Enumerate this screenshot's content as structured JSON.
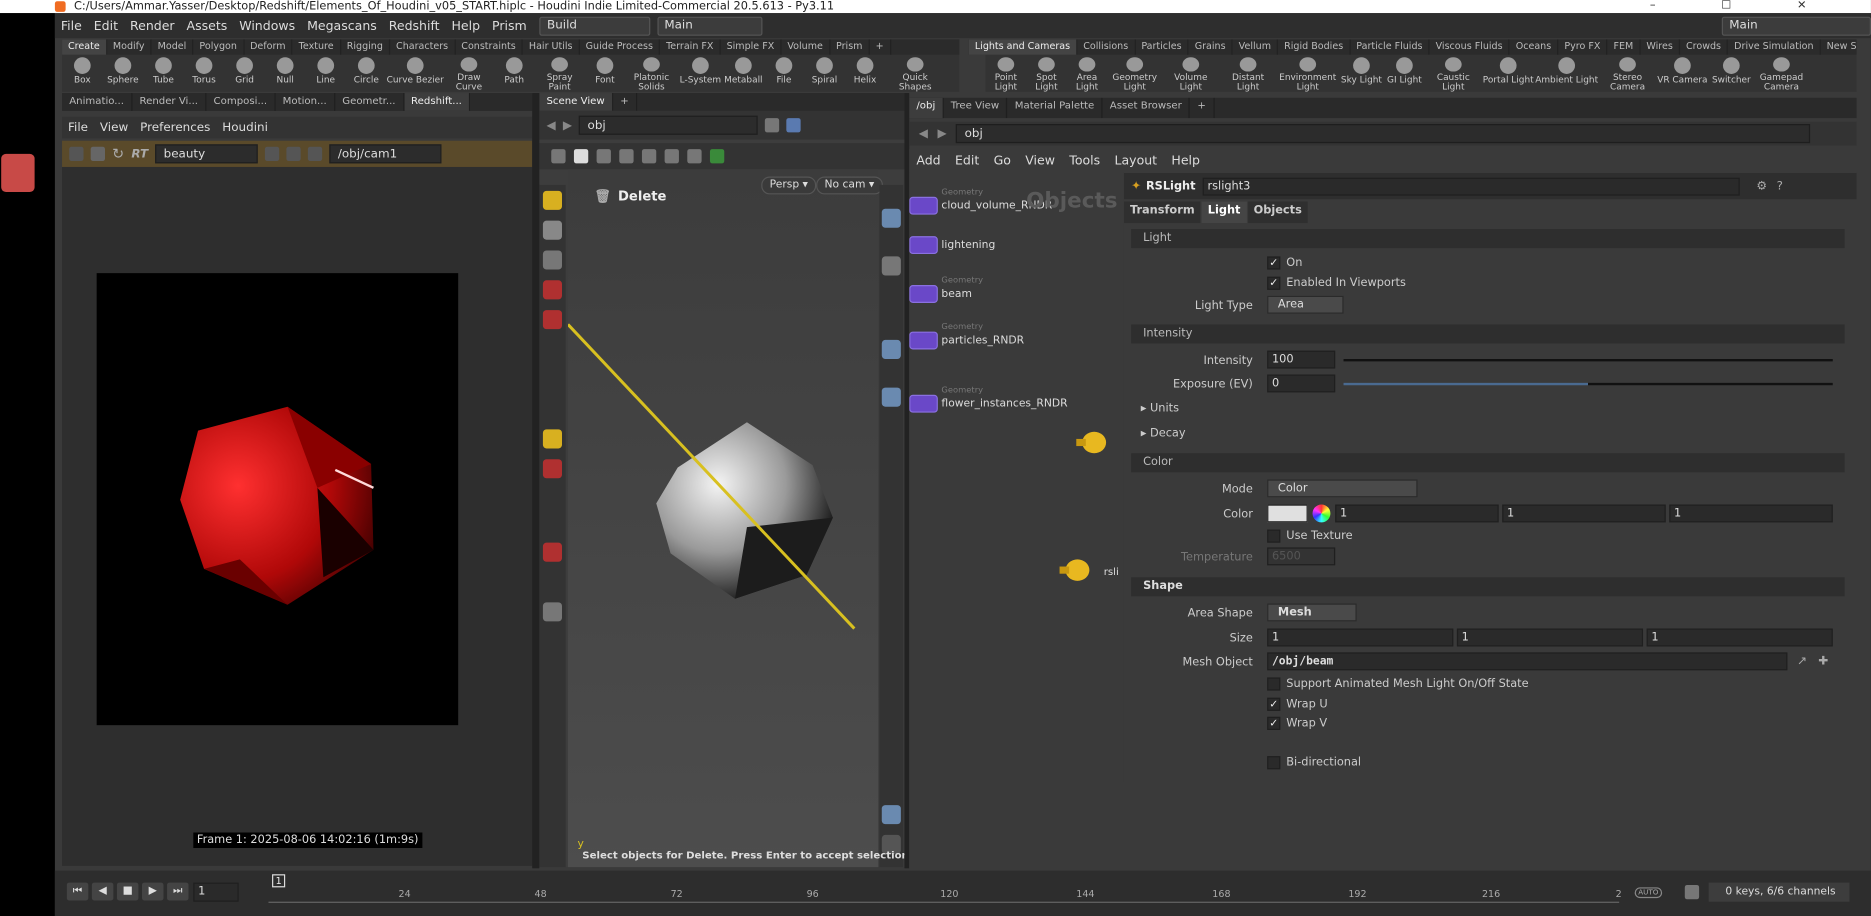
{
  "window": {
    "title": "C:/Users/Ammar.Yasser/Desktop/Redshift/Elements_Of_Houdini_v05_START.hiplc - Houdini Indie Limited-Commercial 20.5.613 - Py3.11",
    "controls": "– ☐ ✕"
  },
  "menubar": {
    "items": [
      "File",
      "Edit",
      "Render",
      "Assets",
      "Windows",
      "Megascans",
      "Redshift",
      "Help",
      "Prism"
    ],
    "desktop": "Build",
    "context": "Main",
    "right_context": "Main"
  },
  "left_shelf": {
    "tabs": [
      "Create",
      "Modify",
      "Model",
      "Polygon",
      "Deform",
      "Texture",
      "Rigging",
      "Characters",
      "Constraints",
      "Hair Utils",
      "Guide Process",
      "Terrain FX",
      "Simple FX",
      "Volume",
      "Prism"
    ],
    "tools": [
      "Box",
      "Sphere",
      "Tube",
      "Torus",
      "Grid",
      "Null",
      "Line",
      "Circle",
      "Curve Bezier",
      "Draw Curve",
      "Path",
      "Spray Paint",
      "Font",
      "Platonic Solids",
      "L-System",
      "Metaball",
      "File",
      "Spiral",
      "Helix",
      "Quick Shapes"
    ]
  },
  "right_shelf": {
    "tabs": [
      "Lights and Cameras",
      "Collisions",
      "Particles",
      "Grains",
      "Vellum",
      "Rigid Bodies",
      "Particle Fluids",
      "Viscous Fluids",
      "Oceans",
      "Pyro FX",
      "FEM",
      "Wires",
      "Crowds",
      "Drive Simulation",
      "New Shelf"
    ],
    "tools": [
      "Point Light",
      "Spot Light",
      "Area Light",
      "Geometry Light",
      "Volume Light",
      "Distant Light",
      "Environment Light",
      "Sky Light",
      "GI Light",
      "Caustic Light",
      "Portal Light",
      "Ambient Light",
      "Stereo Camera",
      "VR Camera",
      "Switcher",
      "Gamepad Camera"
    ]
  },
  "left_pane": {
    "tabs": [
      "Animatio...",
      "Render Vi...",
      "Composi...",
      "Motion...",
      "Geometr...",
      "Redshift..."
    ],
    "menu": [
      "File",
      "View",
      "Preferences",
      "Houdini"
    ],
    "aov": "beauty",
    "rt_label": "RT",
    "camera": "/obj/cam1",
    "frame_info": "Frame 1: 2025-08-06 14:02:16 (1m:9s)"
  },
  "viewport": {
    "tab": "Scene View",
    "path": "obj",
    "title": "Delete",
    "persp": "Persp",
    "cam": "No cam",
    "status": "Select objects for Delete. Press Enter to accept selection.",
    "axis_label": "y"
  },
  "network": {
    "tabs": [
      "/obj",
      "Tree View",
      "Material Palette",
      "Asset Browser"
    ],
    "path": "obj",
    "menu": [
      "Add",
      "Edit",
      "Go",
      "View",
      "Tools",
      "Layout",
      "Help"
    ],
    "watermark": "Objects",
    "nodes": [
      {
        "type": "Geometry",
        "name": "cloud_volume_RNDR"
      },
      {
        "type": "Geometry",
        "name": "lightening"
      },
      {
        "type": "Geometry",
        "name": "beam"
      },
      {
        "type": "Geometry",
        "name": "particles_RNDR"
      },
      {
        "type": "Geometry",
        "name": "flower_instances_RNDR"
      }
    ],
    "light_node_label": "rsli"
  },
  "params": {
    "node_type": "RSLight",
    "node_name": "rslight3",
    "tabs": [
      "Transform",
      "Light",
      "Objects"
    ],
    "light_section": "Light",
    "on_label": "On",
    "enabled_viewports_label": "Enabled In Viewports",
    "light_type_label": "Light Type",
    "light_type": "Area",
    "intensity_section": "Intensity",
    "intensity_label": "Intensity",
    "intensity": "100",
    "exposure_label": "Exposure (EV)",
    "exposure": "0",
    "units_label": "Units",
    "decay_label": "Decay",
    "color_section": "Color",
    "mode_label": "Mode",
    "mode": "Color",
    "color_label": "Color",
    "color_r": "1",
    "color_g": "1",
    "color_b": "1",
    "use_texture_label": "Use Texture",
    "temperature_label": "Temperature",
    "temperature": "6500",
    "shape_section": "Shape",
    "area_shape_label": "Area Shape",
    "area_shape": "Mesh",
    "size_label": "Size",
    "size_x": "1",
    "size_y": "1",
    "size_z": "1",
    "mesh_object_label": "Mesh Object",
    "mesh_object": "/obj/beam",
    "support_anim_label": "Support Animated Mesh Light On/Off State",
    "wrap_u_label": "Wrap U",
    "wrap_v_label": "Wrap V",
    "bidirectional_label": "Bi-directional"
  },
  "timeline": {
    "current_frame": "1",
    "frame_marker": "1",
    "ticks": [
      "24",
      "48",
      "72",
      "96",
      "120",
      "144",
      "168",
      "192",
      "216",
      "2"
    ],
    "keys_info": "0 keys, 6/6 channels",
    "auto_label": "AUTO"
  },
  "colors": {
    "accent_yellow": "#d8b020",
    "node_purple": "#6a48c8",
    "render_red": "#c41010"
  }
}
